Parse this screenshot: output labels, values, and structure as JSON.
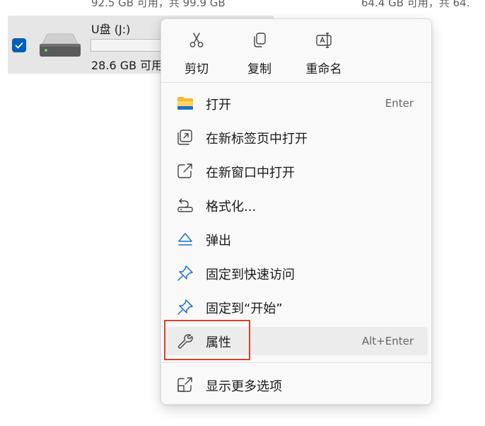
{
  "background": {
    "caption_left": "92.5 GB 可用，共 99.9 GB",
    "caption_right": "64.4 GB 可用，共 64.",
    "drive": {
      "name": "U盘 (J:)",
      "free_text": "28.6 GB 可用",
      "usage_fraction": 0.0,
      "selected": true
    }
  },
  "context_menu": {
    "quick_actions": [
      {
        "label": "剪切",
        "icon": "scissors-icon"
      },
      {
        "label": "复制",
        "icon": "copy-icon"
      },
      {
        "label": "重命名",
        "icon": "rename-icon"
      }
    ],
    "items": [
      {
        "label": "打开",
        "shortcut": "Enter",
        "icon": "folder-icon"
      },
      {
        "label": "在新标签页中打开",
        "shortcut": "",
        "icon": "open-new-tab-icon"
      },
      {
        "label": "在新窗口中打开",
        "shortcut": "",
        "icon": "open-new-window-icon"
      },
      {
        "label": "格式化...",
        "shortcut": "",
        "icon": "format-icon"
      },
      {
        "label": "弹出",
        "shortcut": "",
        "icon": "eject-icon"
      },
      {
        "label": "固定到快速访问",
        "shortcut": "",
        "icon": "pin-icon"
      },
      {
        "label": "固定到“开始”",
        "shortcut": "",
        "icon": "pin-start-icon"
      },
      {
        "label": "属性",
        "shortcut": "Alt+Enter",
        "icon": "wrench-icon",
        "hovered": true
      }
    ],
    "more_options": {
      "label": "显示更多选项",
      "icon": "more-options-icon"
    }
  },
  "colors": {
    "accent": "#005fb8",
    "highlight_outline": "#d9412b",
    "folder_yellow": "#f5b82e"
  }
}
